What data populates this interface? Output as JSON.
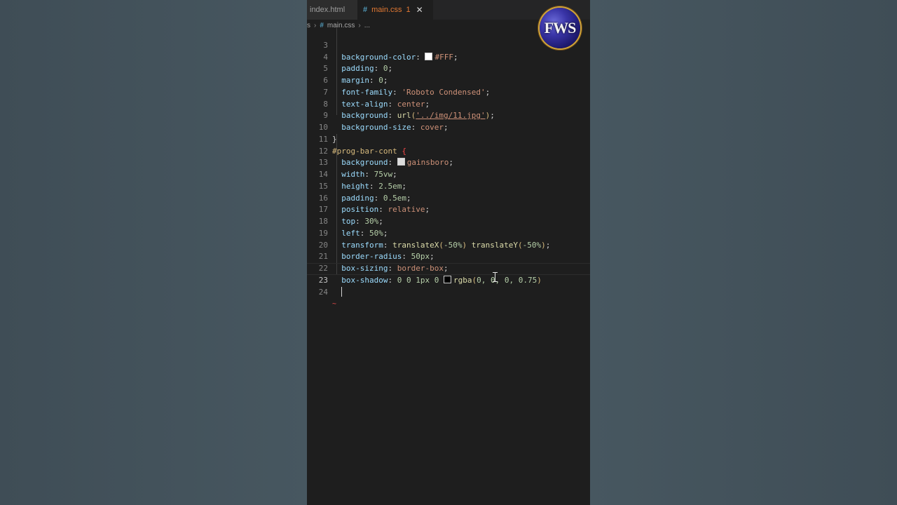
{
  "tabs": [
    {
      "label": "index.html"
    },
    {
      "label": "main.css",
      "icon": "#",
      "badge": "1",
      "close": "✕"
    }
  ],
  "breadcrumb": {
    "lead": "s",
    "file_icon": "#",
    "file": "main.css",
    "tail": "..."
  },
  "logo": {
    "text": "FWS"
  },
  "code_lines": [
    {
      "n": "3"
    },
    {
      "n": "4"
    },
    {
      "n": "5"
    },
    {
      "n": "6"
    },
    {
      "n": "7"
    },
    {
      "n": "8"
    },
    {
      "n": "9"
    },
    {
      "n": "10"
    },
    {
      "n": "11"
    },
    {
      "n": "12"
    },
    {
      "n": "13"
    },
    {
      "n": "14"
    },
    {
      "n": "15"
    },
    {
      "n": "16"
    },
    {
      "n": "17"
    },
    {
      "n": "18"
    },
    {
      "n": "19"
    },
    {
      "n": "20"
    },
    {
      "n": "21"
    },
    {
      "n": "22"
    },
    {
      "n": "23"
    },
    {
      "n": "24"
    }
  ],
  "code": {
    "l3": {
      "prop": "background-color",
      "val": "#FFF"
    },
    "l4": {
      "prop": "padding",
      "val": "0"
    },
    "l5": {
      "prop": "margin",
      "val": "0"
    },
    "l6": {
      "prop": "font-family",
      "val": "'Roboto Condensed'"
    },
    "l7": {
      "prop": "text-align",
      "val": "center"
    },
    "l8": {
      "prop": "background",
      "fn": "url",
      "arg": "'../img/11.jpg'"
    },
    "l9": {
      "prop": "background-size",
      "val": "cover"
    },
    "l10": {
      "brace": "}"
    },
    "l11": {
      "selector": "#prog-bar-cont",
      "brace": "{"
    },
    "l12": {
      "prop": "background",
      "val": "gainsboro"
    },
    "l13": {
      "prop": "width",
      "val": "75vw"
    },
    "l14": {
      "prop": "height",
      "val": "2.5em"
    },
    "l15": {
      "prop": "padding",
      "val": "0.5em"
    },
    "l16": {
      "prop": "position",
      "val": "relative"
    },
    "l17": {
      "prop": "top",
      "val": "30%"
    },
    "l18": {
      "prop": "left",
      "val": "50%"
    },
    "l19": {
      "prop": "transform",
      "fn1": "translateX",
      "arg1": "-50%",
      "fn2": "translateY",
      "arg2": "-50%"
    },
    "l20": {
      "prop": "border-radius",
      "val": "50px"
    },
    "l21": {
      "prop": "box-sizing",
      "val": "border-box"
    },
    "l22": {
      "prop": "box-shadow",
      "val": "0 0 1px 0",
      "fn": "rgba",
      "arg": "0, 0, 0, 0.75"
    }
  },
  "colors": {
    "white_swatch": "#FFFFFF",
    "gainsboro_swatch": "#DCDCDC",
    "black_swatch": "#000000",
    "tab_accent": "#e37933"
  }
}
